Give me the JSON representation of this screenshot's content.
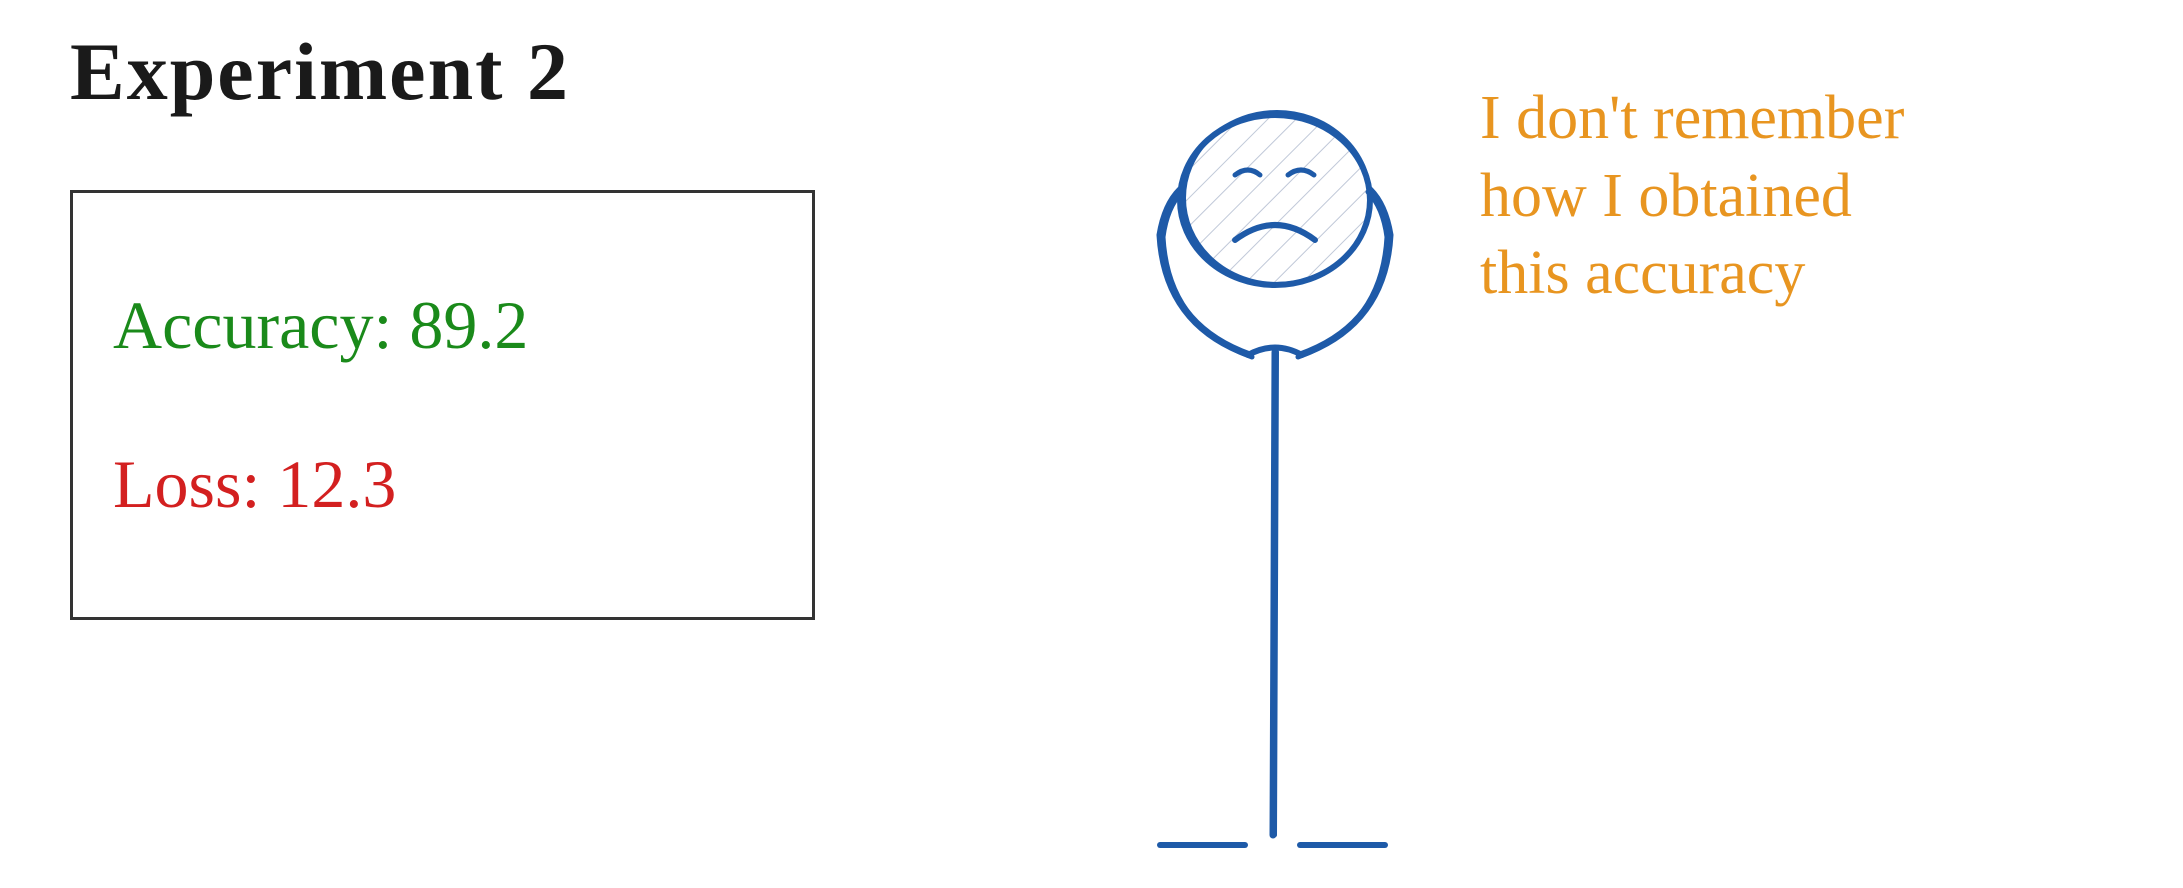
{
  "title": "Experiment 2",
  "results": {
    "accuracy_label": "Accuracy:",
    "accuracy_value": "89.2",
    "loss_label": "Loss:",
    "loss_value": "12.3"
  },
  "speech": {
    "line1": "I don't remember",
    "line2": "how I obtained",
    "line3": "this accuracy"
  },
  "colors": {
    "title": "#1a1a1a",
    "accuracy": "#1a8a1a",
    "loss": "#d32020",
    "figure": "#1e5aa8",
    "speech": "#e89520"
  }
}
